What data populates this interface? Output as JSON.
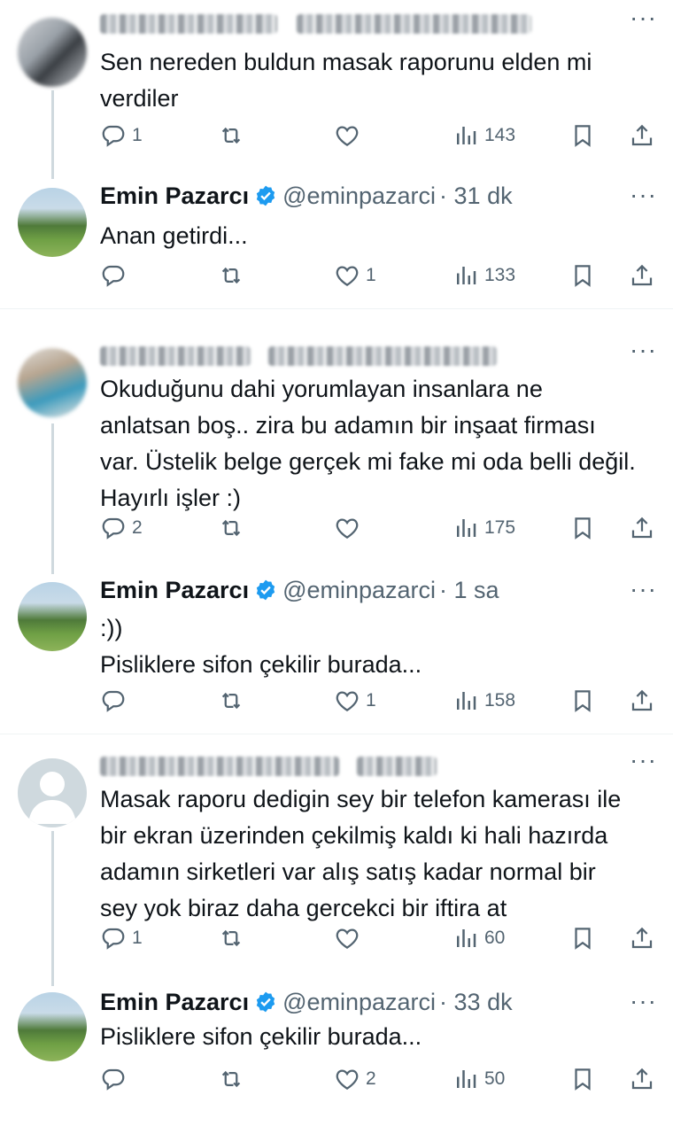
{
  "tweets": [
    {
      "name": "",
      "handle": "",
      "time": "",
      "text": [
        "Sen nereden buldun masak raporunu elden mi",
        "verdiler"
      ],
      "stats": {
        "replies": "1",
        "retweets": "",
        "likes": "",
        "views": "143"
      }
    },
    {
      "name": "Emin Pazarcı",
      "handle": "@eminpazarci",
      "time": "· 31 dk",
      "text": [
        "Anan getirdi..."
      ],
      "stats": {
        "replies": "",
        "retweets": "",
        "likes": "1",
        "views": "133"
      }
    },
    {
      "name": "",
      "handle": "",
      "time": "",
      "text": [
        "Okuduğunu dahi yorumlayan insanlara ne",
        "anlatsan boş.. zira bu adamın bir inşaat firması",
        "var. Üstelik belge gerçek mi fake mi oda belli değil.",
        "Hayırlı işler :)"
      ],
      "stats": {
        "replies": "2",
        "retweets": "",
        "likes": "",
        "views": "175"
      }
    },
    {
      "name": "Emin Pazarcı",
      "handle": "@eminpazarci",
      "time": "· 1 sa",
      "text": [
        ":))",
        "Pisliklere sifon çekilir burada..."
      ],
      "stats": {
        "replies": "",
        "retweets": "",
        "likes": "1",
        "views": "158"
      }
    },
    {
      "name": "",
      "handle": "",
      "time": "",
      "text": [
        "Masak raporu dedigin sey bir telefon kamerası ile",
        "bir ekran üzerinden çekilmiş kaldı ki hali hazırda",
        "adamın sirketleri var alış satış kadar normal bir",
        "sey yok biraz daha gercekci bir iftira at"
      ],
      "stats": {
        "replies": "1",
        "retweets": "",
        "likes": "",
        "views": "60"
      }
    },
    {
      "name": "Emin Pazarcı",
      "handle": "@eminpazarci",
      "time": "· 33 dk",
      "text": [
        "Pisliklere sifon çekilir burada..."
      ],
      "stats": {
        "replies": "",
        "retweets": "",
        "likes": "2",
        "views": "50"
      }
    }
  ],
  "colors": {
    "verified": "#1d9bf0",
    "muted": "#536471",
    "text": "#0f1419",
    "thread_line": "#cfd9de"
  },
  "icons": [
    "reply-icon",
    "retweet-icon",
    "like-icon",
    "views-icon",
    "bookmark-icon",
    "share-icon",
    "more-icon",
    "verified-icon"
  ]
}
